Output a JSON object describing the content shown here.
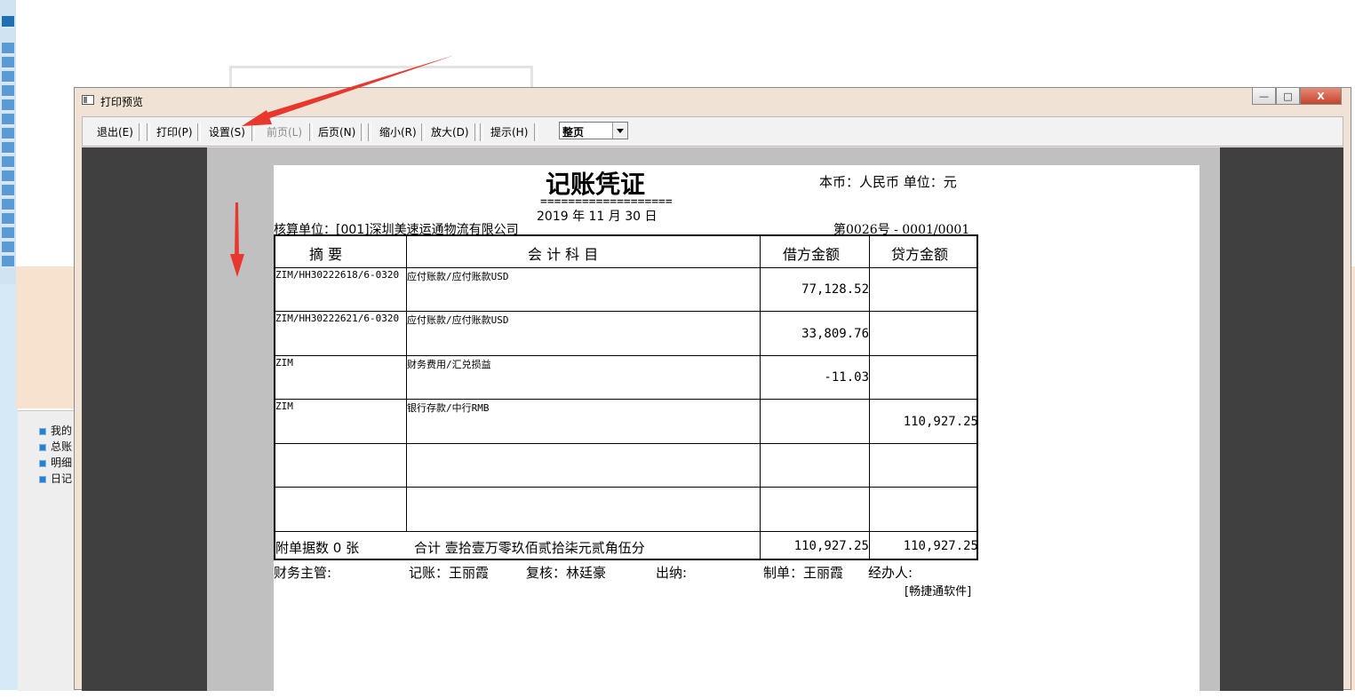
{
  "window": {
    "title": "打印预览",
    "minimize": "—",
    "maximize": "□",
    "close": "X"
  },
  "toolbar": {
    "exit": "退出(E)",
    "print": "打印(P)",
    "setup": "设置(S)",
    "prev_page": "前页(L)",
    "next_page": "后页(N)",
    "zoom_out": "缩小(R)",
    "zoom_in": "放大(D)",
    "hint": "提示(H)",
    "zoom_value": "整页"
  },
  "background_tree": [
    "我的",
    "总账",
    "明细",
    "日记"
  ],
  "voucher": {
    "title": "记账凭证",
    "title_underline": "===================",
    "currency_unit": "本币：人民币   单位：元",
    "date": "2019 年  11  月  30 日",
    "org": "核算单位：[001]深圳美速运通物流有限公司",
    "voucher_no": "第0026号 - 0001/0001",
    "headers": {
      "summary": "摘        要",
      "account": "会   计   科   目",
      "debit": "借方金额",
      "credit": "贷方金额"
    },
    "rows": [
      {
        "summary": "ZIM/HH30222618/6-0320",
        "account": "应付账款/应付账款USD",
        "debit": "77,128.52",
        "credit": ""
      },
      {
        "summary": "ZIM/HH30222621/6-0320",
        "account": "应付账款/应付账款USD",
        "debit": "33,809.76",
        "credit": ""
      },
      {
        "summary": "ZIM",
        "account": "财务费用/汇兑损益",
        "debit": "-11.03",
        "credit": ""
      },
      {
        "summary": "ZIM",
        "account": "银行存款/中行RMB",
        "debit": "",
        "credit": "110,927.25"
      },
      {
        "summary": "",
        "account": "",
        "debit": "",
        "credit": ""
      },
      {
        "summary": "",
        "account": "",
        "debit": "",
        "credit": ""
      }
    ],
    "footer": {
      "attachments": "附单据数    0    张",
      "total_text": "合计  壹拾壹万零玖佰贰拾柒元贰角伍分",
      "debit_total": "110,927.25",
      "credit_total": "110,927.25"
    },
    "signatures": {
      "supervisor": "财务主管:",
      "bookkeeper": "记账：王丽霞",
      "reviewer": "复核：林廷豪",
      "cashier": "出纳:",
      "preparer": "制单：王丽霞",
      "handler": "经办人:"
    },
    "software": "[畅捷通软件]"
  },
  "colors": {
    "annotation_arrow": "#e8372c",
    "preview_bg": "#404040",
    "gutter": "#c0c0c0",
    "window_frame": "#f0e3d6"
  }
}
